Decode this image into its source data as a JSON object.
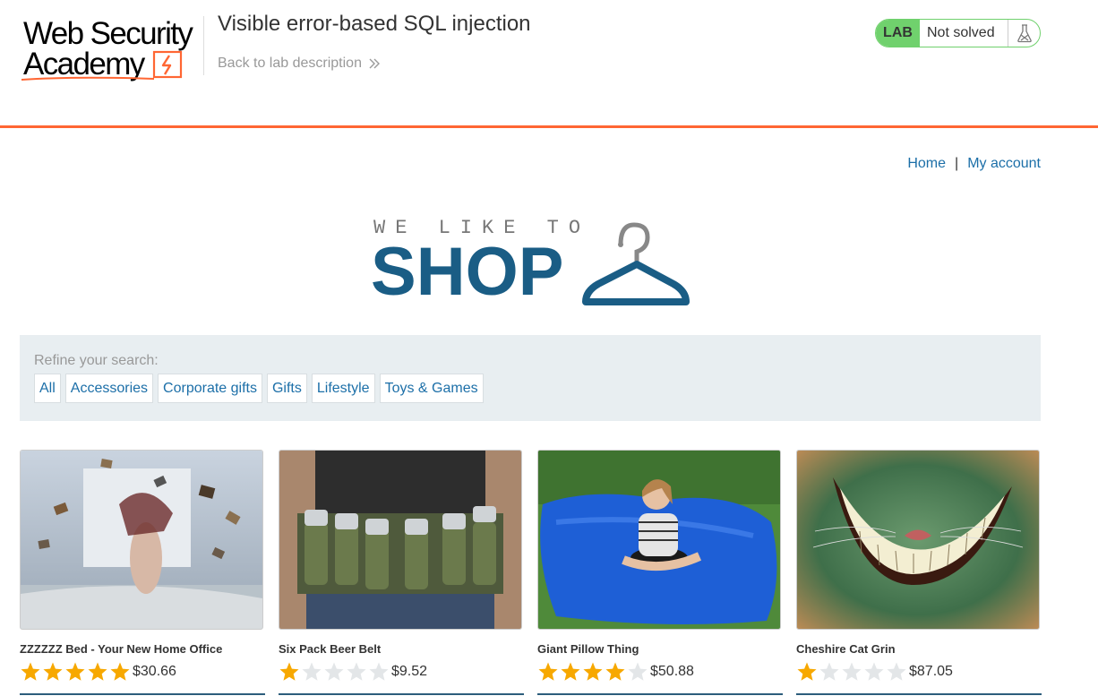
{
  "header": {
    "logo_line1": "Web Security",
    "logo_line2": "Academy",
    "lab_title": "Visible error-based SQL injection",
    "back_link": "Back to lab description",
    "lab_tag": "LAB",
    "lab_status": "Not solved",
    "accent_color": "#ff6633",
    "status_color": "#70d16d"
  },
  "nav": {
    "home": "Home",
    "separator": "|",
    "my_account": "My account"
  },
  "banner": {
    "small_text": "WE LIKE TO",
    "big_text": "SHOP",
    "icon": "hanger-icon"
  },
  "filter": {
    "label": "Refine your search:",
    "categories": [
      "All",
      "Accessories",
      "Corporate gifts",
      "Gifts",
      "Lifestyle",
      "Toys & Games"
    ]
  },
  "products": [
    {
      "name": "ZZZZZZ Bed - Your New Home Office",
      "rating": 5,
      "price": "$30.66"
    },
    {
      "name": "Six Pack Beer Belt",
      "rating": 1,
      "price": "$9.52"
    },
    {
      "name": "Giant Pillow Thing",
      "rating": 4,
      "price": "$50.88"
    },
    {
      "name": "Cheshire Cat Grin",
      "rating": 1,
      "price": "$87.05"
    }
  ]
}
